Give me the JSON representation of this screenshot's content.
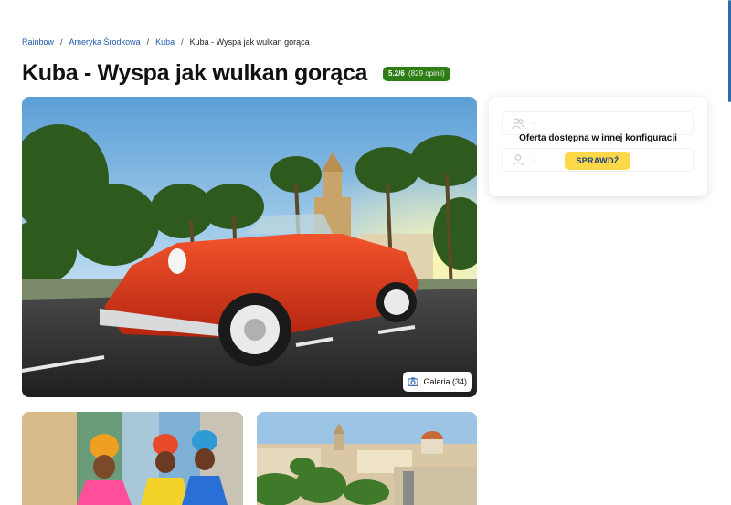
{
  "breadcrumb": {
    "items": [
      "Rainbow",
      "Ameryka Środkowa",
      "Kuba"
    ],
    "current": "Kuba - Wyspa jak wulkan gorąca",
    "separator": "/"
  },
  "title": "Kuba - Wyspa jak wulkan gorąca",
  "rating": {
    "score": "5.2/6",
    "reviews": "(829 opinii)",
    "color": "#2e7d14"
  },
  "gallery": {
    "label": "Galeria (34)",
    "icon": "camera-icon"
  },
  "offer_panel": {
    "row1_value": "-",
    "row1_icon": "participants-icon",
    "row2_value": "-",
    "row2_icon": "person-icon",
    "message": "Oferta dostępna w innej konfiguracji",
    "button_label": "SPRAWDŹ",
    "button_color": "#ffd84a"
  },
  "colors": {
    "link": "#1f5aa8",
    "accent_blue": "#1d3f7a"
  }
}
